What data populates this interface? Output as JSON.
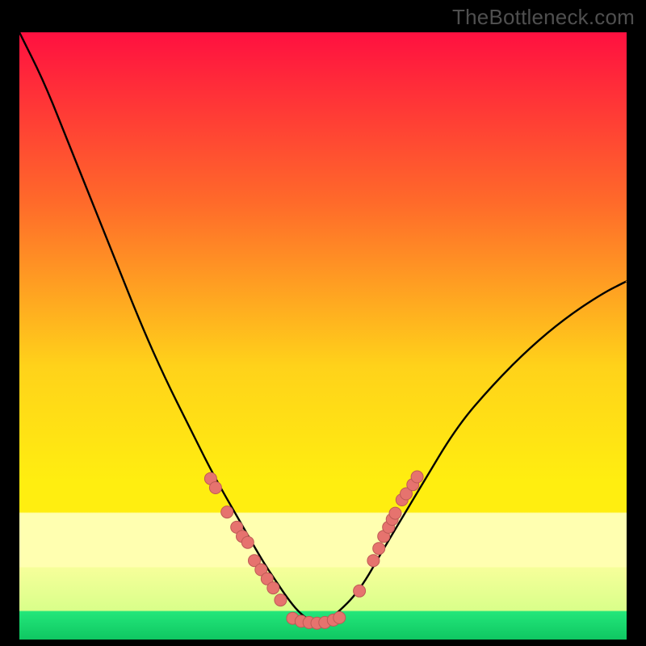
{
  "watermark": "TheBottleneck.com",
  "colors": {
    "gradient_top": "#ff1040",
    "gradient_mid1": "#ff6a2a",
    "gradient_mid2": "#ffd21a",
    "gradient_mid3": "#ffee10",
    "gradient_band_pale": "#ffffb0",
    "gradient_bottom_green": "#23e67a",
    "gradient_bottom_green2": "#0fc762",
    "curve": "#000000",
    "dots_fill": "#e6736e",
    "dots_stroke": "#be5a55"
  },
  "chart_data": {
    "type": "line",
    "title": "",
    "xlabel": "",
    "ylabel": "",
    "xlim": [
      0,
      100
    ],
    "ylim": [
      0,
      100
    ],
    "series": [
      {
        "name": "bottleneck-curve",
        "x": [
          0,
          4,
          8,
          12,
          16,
          20,
          24,
          28,
          32,
          36,
          40,
          42,
          44,
          46,
          48,
          50,
          52,
          56,
          60,
          66,
          72,
          78,
          84,
          90,
          96,
          100
        ],
        "y": [
          100,
          92,
          82,
          72,
          62,
          52,
          43,
          35,
          27,
          20,
          13,
          10,
          7,
          4.5,
          3,
          2.7,
          4,
          8,
          15,
          25,
          35,
          42,
          48,
          53,
          57,
          59
        ]
      }
    ],
    "scatter": [
      {
        "name": "dots-left-arm",
        "points": [
          [
            31.5,
            26.5
          ],
          [
            32.3,
            25.0
          ],
          [
            34.2,
            21.0
          ],
          [
            35.8,
            18.5
          ],
          [
            36.7,
            17.0
          ],
          [
            37.6,
            16.0
          ],
          [
            38.7,
            13.0
          ],
          [
            39.8,
            11.5
          ],
          [
            40.8,
            10.0
          ],
          [
            41.8,
            8.5
          ],
          [
            43.0,
            6.5
          ]
        ]
      },
      {
        "name": "dots-valley",
        "points": [
          [
            45.0,
            3.5
          ],
          [
            46.4,
            3.0
          ],
          [
            47.7,
            2.8
          ],
          [
            49.0,
            2.7
          ],
          [
            50.3,
            2.8
          ],
          [
            51.7,
            3.2
          ],
          [
            52.7,
            3.6
          ]
        ]
      },
      {
        "name": "dots-right-arm",
        "points": [
          [
            56.0,
            8.0
          ],
          [
            58.3,
            13.0
          ],
          [
            59.2,
            15.0
          ],
          [
            60.0,
            17.0
          ],
          [
            60.8,
            18.5
          ],
          [
            61.4,
            19.8
          ],
          [
            61.9,
            20.8
          ],
          [
            63.0,
            23.0
          ],
          [
            63.7,
            24.0
          ],
          [
            64.8,
            25.5
          ],
          [
            65.5,
            26.8
          ]
        ]
      }
    ]
  }
}
